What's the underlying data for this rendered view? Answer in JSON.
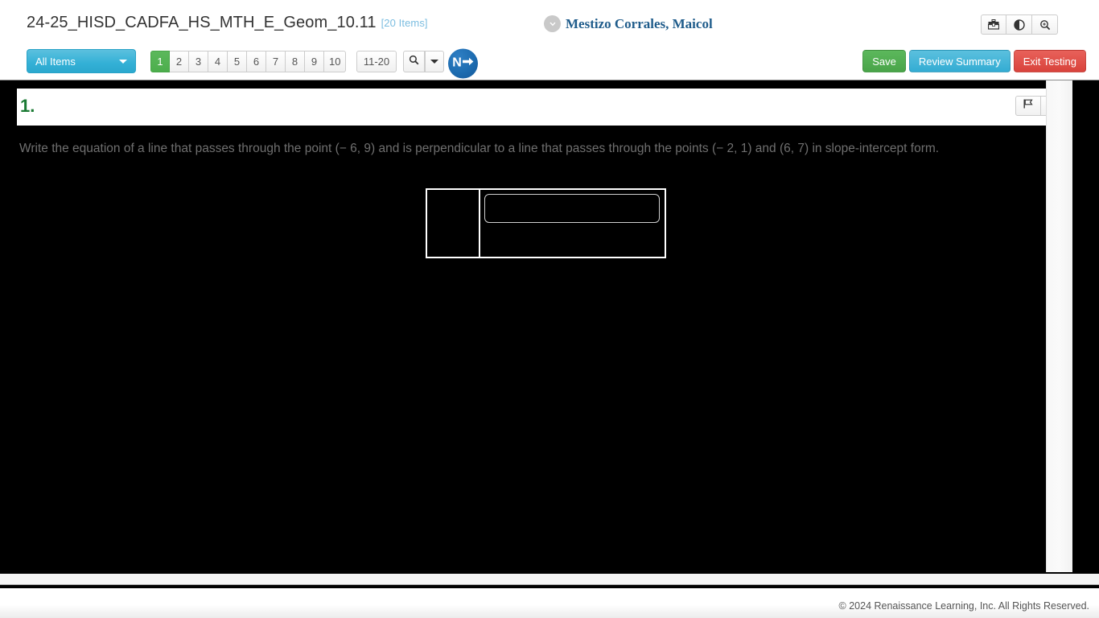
{
  "header": {
    "assessment_title": "24-25_HISD_CADFA_HS_MTH_E_Geom_10.11",
    "item_count_label": "[20 Items]",
    "student_name": "Mestizo Corrales, Maicol",
    "student_chevron_icon": "chevron-down-icon",
    "utilities": [
      {
        "icon": "toolbox-icon",
        "name": "tools-button"
      },
      {
        "icon": "contrast-icon",
        "name": "contrast-button"
      },
      {
        "icon": "magnifier-icon",
        "name": "zoom-button"
      }
    ]
  },
  "toolbar": {
    "filter_label": "All Items",
    "filter_caret_icon": "caret-down-icon",
    "pages": [
      "1",
      "2",
      "3",
      "4",
      "5",
      "6",
      "7",
      "8",
      "9",
      "10"
    ],
    "active_page": "1",
    "page_range_label": "11-20",
    "search_icon": "search-icon",
    "search_caret_icon": "caret-down-icon",
    "next_button_label": "N",
    "next_button_icon": "arrow-right-icon",
    "save_label": "Save",
    "review_summary_label": "Review Summary",
    "exit_testing_label": "Exit Testing",
    "colors": {
      "save": "#5cb85c",
      "review": "#5bc0de",
      "exit": "#d9433c",
      "active_page": "#5cb85c",
      "filter": "#33b0d6"
    }
  },
  "question": {
    "number_label": "1.",
    "number_color": "#1a7a33",
    "text": "Write the equation of a line that passes through the point (− 6, 9) and is perpendicular to a line that passes through the points (− 2, 1) and (6, 7) in slope-intercept form.",
    "tools": [
      {
        "icon": "flag-icon",
        "name": "flag-question-button"
      },
      {
        "icon": "pencil-edit-icon",
        "name": "annotate-question-button"
      }
    ],
    "answer": {
      "left_cell_value": "",
      "input_value": "",
      "input_placeholder": ""
    }
  },
  "footer": {
    "copyright": "© 2024 Renaissance Learning, Inc. All Rights Reserved."
  }
}
